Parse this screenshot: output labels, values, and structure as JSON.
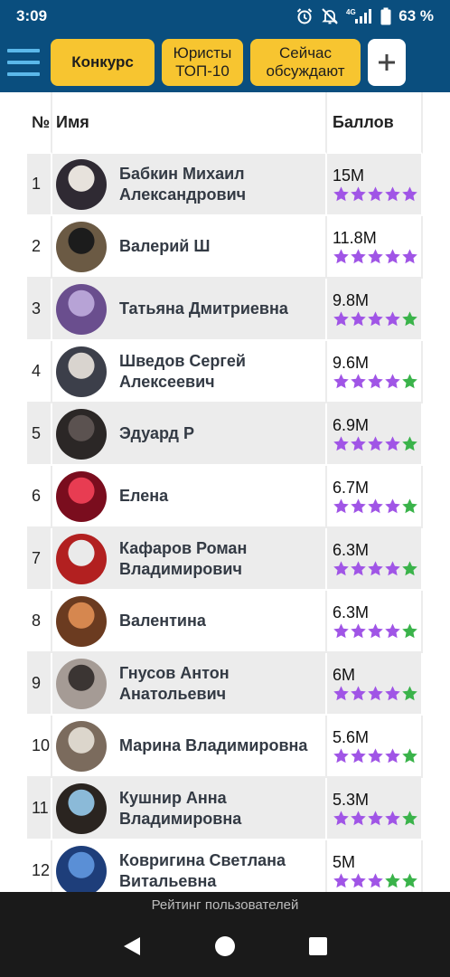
{
  "status_bar": {
    "time": "3:09",
    "network": "4G",
    "battery": "63 %",
    "icons": [
      "alarm-icon",
      "mute-icon",
      "signal-icon",
      "battery-icon"
    ]
  },
  "header": {
    "menu_icon": "hamburger-icon",
    "buttons": [
      {
        "label": "Конкурс"
      },
      {
        "label_line1": "Юристы",
        "label_line2": "ТОП-10"
      },
      {
        "label_line1": "Сейчас",
        "label_line2": "обсуждают"
      }
    ],
    "plus_icon": "plus-icon"
  },
  "colors": {
    "header_bg": "#0a4e7e",
    "button_bg": "#f7c530",
    "star_purple": "#a055e6",
    "star_green": "#3ab34a",
    "row_alt": "#ececec"
  },
  "table": {
    "columns": {
      "num": "№",
      "name": "Имя",
      "score": "Баллов"
    },
    "rows": [
      {
        "num": "1",
        "name_line1": "Бабкин Михаил",
        "name_line2": "Александрович",
        "score": "15M",
        "stars": [
          "purple",
          "purple",
          "purple",
          "purple",
          "purple"
        ]
      },
      {
        "num": "2",
        "name_line1": "Валерий Ш",
        "name_line2": "",
        "score": "11.8M",
        "stars": [
          "purple",
          "purple",
          "purple",
          "purple",
          "purple"
        ]
      },
      {
        "num": "3",
        "name_line1": "Татьяна Дмитриевна",
        "name_line2": "",
        "score": "9.8M",
        "stars": [
          "purple",
          "purple",
          "purple",
          "purple",
          "green"
        ]
      },
      {
        "num": "4",
        "name_line1": "Шведов Сергей",
        "name_line2": "Алексеевич",
        "score": "9.6M",
        "stars": [
          "purple",
          "purple",
          "purple",
          "purple",
          "green"
        ]
      },
      {
        "num": "5",
        "name_line1": "Эдуард Р",
        "name_line2": "",
        "score": "6.9M",
        "stars": [
          "purple",
          "purple",
          "purple",
          "purple",
          "green"
        ]
      },
      {
        "num": "6",
        "name_line1": "Елена",
        "name_line2": "",
        "score": "6.7M",
        "stars": [
          "purple",
          "purple",
          "purple",
          "purple",
          "green"
        ]
      },
      {
        "num": "7",
        "name_line1": "Кафаров Роман",
        "name_line2": "Владимирович",
        "score": "6.3M",
        "stars": [
          "purple",
          "purple",
          "purple",
          "purple",
          "green"
        ]
      },
      {
        "num": "8",
        "name_line1": "Валентина",
        "name_line2": "",
        "score": "6.3M",
        "stars": [
          "purple",
          "purple",
          "purple",
          "purple",
          "green"
        ]
      },
      {
        "num": "9",
        "name_line1": "Гнусов Антон",
        "name_line2": "Анатольевич",
        "score": "6M",
        "stars": [
          "purple",
          "purple",
          "purple",
          "purple",
          "green"
        ]
      },
      {
        "num": "10",
        "name_line1": "Марина Владимировна",
        "name_line2": "",
        "score": "5.6M",
        "stars": [
          "purple",
          "purple",
          "purple",
          "purple",
          "green"
        ]
      },
      {
        "num": "11",
        "name_line1": "Кушнир Анна",
        "name_line2": "Владимировна",
        "score": "5.3M",
        "stars": [
          "purple",
          "purple",
          "purple",
          "purple",
          "green"
        ]
      },
      {
        "num": "12",
        "name_line1": "Ковригина Светлана",
        "name_line2": "Витальевна",
        "score": "5M",
        "stars": [
          "purple",
          "purple",
          "purple",
          "green",
          "green"
        ]
      }
    ]
  },
  "footer": {
    "label": "Рейтинг пользователей",
    "nav": [
      "back-icon",
      "home-icon",
      "recents-icon"
    ]
  }
}
